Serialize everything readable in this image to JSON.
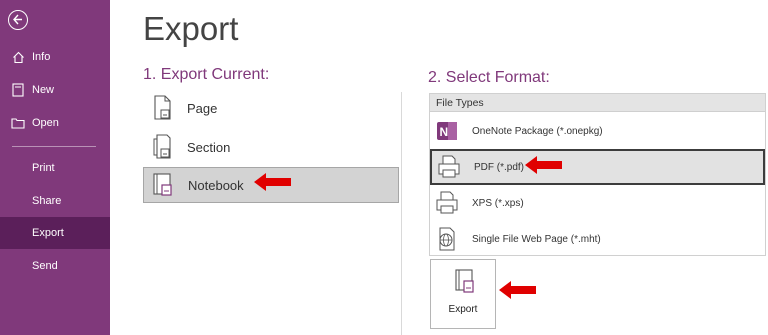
{
  "sidebar": {
    "items": [
      {
        "label": "Info",
        "icon": "home-icon"
      },
      {
        "label": "New",
        "icon": "new-page-icon"
      },
      {
        "label": "Open",
        "icon": "folder-icon"
      },
      {
        "label": "Print"
      },
      {
        "label": "Share"
      },
      {
        "label": "Export",
        "active": true
      },
      {
        "label": "Send"
      }
    ],
    "background": "#80397B",
    "active_background": "#5B1F5A"
  },
  "page": {
    "title": "Export",
    "export_current_heading": "1. Export Current:",
    "select_format_heading": "2. Select Format:"
  },
  "export_current": {
    "items": [
      {
        "label": "Page"
      },
      {
        "label": "Section"
      },
      {
        "label": "Notebook",
        "selected": true
      }
    ]
  },
  "file_types": {
    "header": "File Types",
    "items": [
      {
        "label": "OneNote Package (*.onepkg)",
        "icon": "onenote-icon"
      },
      {
        "label": "PDF (*.pdf)",
        "icon": "printer-icon",
        "selected": true
      },
      {
        "label": "XPS (*.xps)",
        "icon": "printer-icon"
      },
      {
        "label": "Single File Web Page (*.mht)",
        "icon": "web-page-icon"
      }
    ]
  },
  "export_button": {
    "label": "Export"
  },
  "accent_color": "#80397B",
  "annotation_arrow_color": "#E00000"
}
